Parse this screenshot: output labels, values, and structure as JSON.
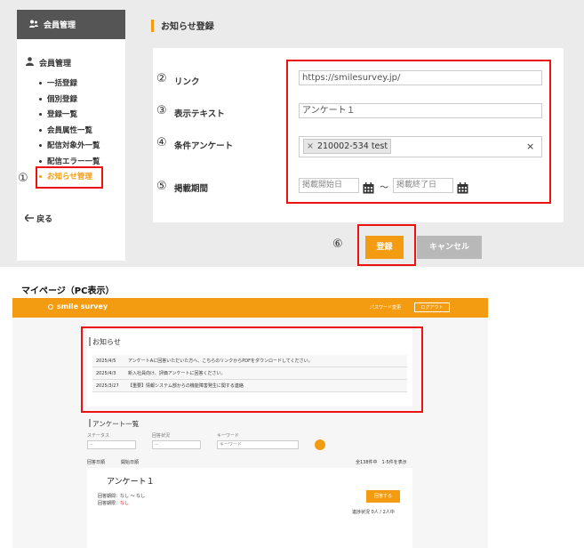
{
  "sidebar": {
    "header": "会員管理",
    "section": "会員管理",
    "items": [
      {
        "label": "一括登録"
      },
      {
        "label": "個別登録"
      },
      {
        "label": "登録一覧"
      },
      {
        "label": "会員属性一覧"
      },
      {
        "label": "配信対象外一覧"
      },
      {
        "label": "配信エラー一覧"
      },
      {
        "label": "お知らせ管理"
      }
    ],
    "back": "戻る"
  },
  "page": {
    "title": "お知らせ登録"
  },
  "form": {
    "link_label": "リンク",
    "link_value": "https://smilesurvey.jp/",
    "text_label": "表示テキスト",
    "text_value": "アンケート１",
    "survey_label": "条件アンケート",
    "survey_tag": "210002-534 test",
    "tag_remove": "×",
    "clear": "×",
    "period_label": "掲載期間",
    "start_placeholder": "掲載開始日",
    "end_placeholder": "掲載終了日",
    "tilde": "～"
  },
  "markers": [
    "①",
    "②",
    "③",
    "④",
    "⑤",
    "⑥"
  ],
  "buttons": {
    "register": "登録",
    "cancel": "キャンセル"
  },
  "mypage": {
    "caption": "マイページ（PC表示）",
    "logo": "smile survey",
    "password_link": "パスワード変更",
    "logout": "ログアウト",
    "notice": {
      "title": "お知らせ",
      "rows": [
        {
          "date": "2025/4/5",
          "text": "アンケートAに回答いただいた方へ、こちらのリンクからPDFをダウンロードしてください。"
        },
        {
          "date": "2025/4/3",
          "text": "新入社員向け、評価アンケートに回答ください。"
        },
        {
          "date": "2025/3/27",
          "text": "【重要】情報システム部からの機能障害発生に関する連絡"
        }
      ]
    },
    "survey": {
      "title": "アンケート一覧",
      "filter_status": "ステータス",
      "filter_answer": "回答状況",
      "filter_keyword": "キーワード",
      "select_default": "--",
      "keyword_placeholder": "キーワード",
      "sort_answer": "回答日順",
      "sort_open": "開始日順",
      "count": "全138件中　1-5件を表示",
      "card_title": "アンケート１",
      "period_text": "回答期間：なし ～ なし",
      "deadline_label": "回答期限：",
      "deadline_value": "なし",
      "answer_button": "回答する",
      "progress": "進捗状況 0人 / 2人中"
    }
  },
  "colors": {
    "accent": "#f39c12",
    "highlight": "#e11111"
  }
}
